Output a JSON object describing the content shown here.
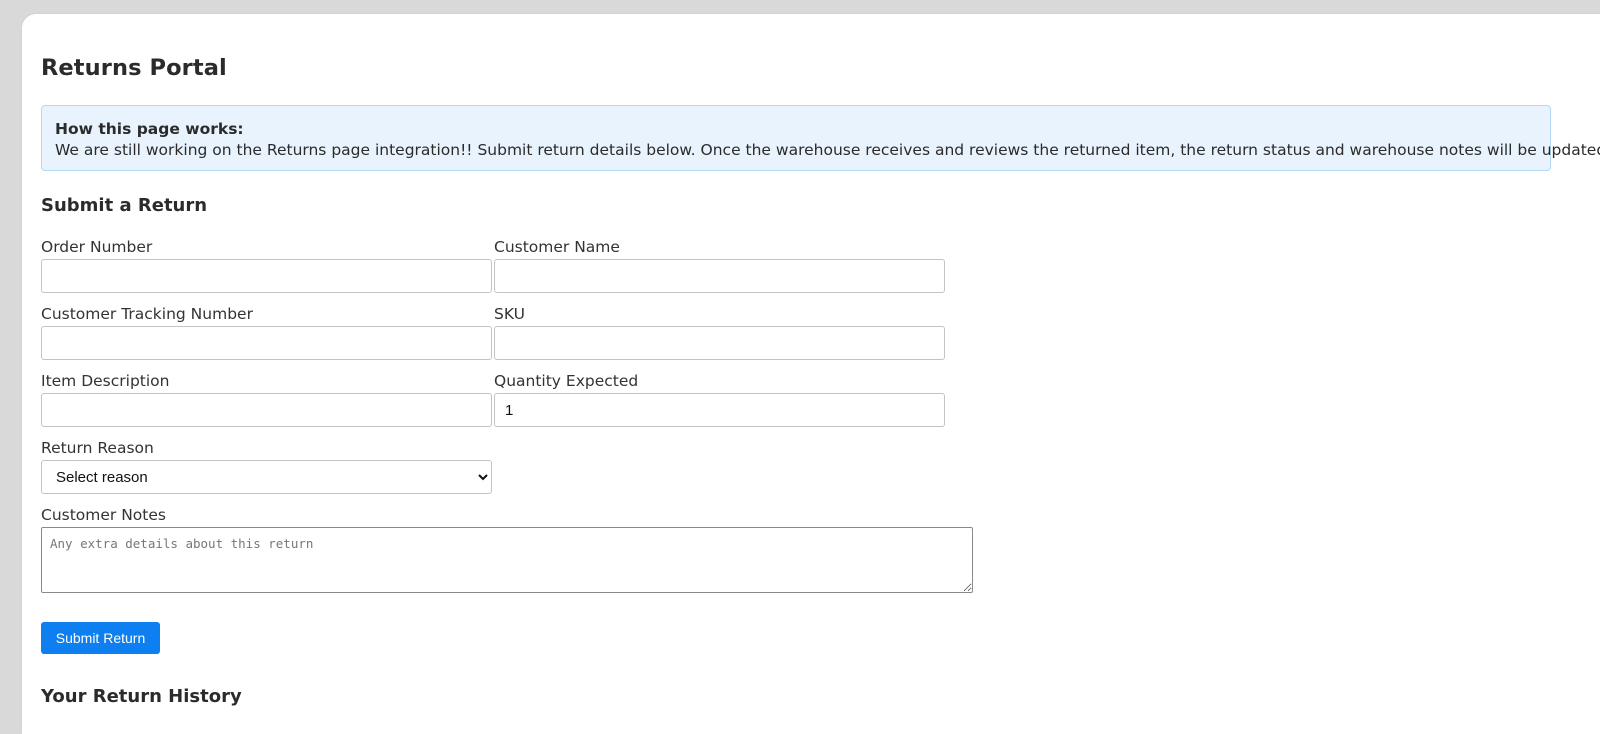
{
  "page": {
    "title": "Returns Portal"
  },
  "info_box": {
    "title": "How this page works:",
    "text": "We are still working on the Returns page integration!! Submit return details below. Once the warehouse receives and reviews the returned item, the return status and warehouse notes will be updated here."
  },
  "form": {
    "heading": "Submit a Return",
    "order_number": {
      "label": "Order Number",
      "value": ""
    },
    "customer_name": {
      "label": "Customer Name",
      "value": ""
    },
    "tracking_number": {
      "label": "Customer Tracking Number",
      "value": ""
    },
    "sku": {
      "label": "SKU",
      "value": ""
    },
    "item_description": {
      "label": "Item Description",
      "value": ""
    },
    "quantity_expected": {
      "label": "Quantity Expected",
      "value": "1"
    },
    "return_reason": {
      "label": "Return Reason",
      "selected": "Select reason"
    },
    "customer_notes": {
      "label": "Customer Notes",
      "placeholder": "Any extra details about this return"
    },
    "submit_label": "Submit Return"
  },
  "history": {
    "heading": "Your Return History"
  },
  "colors": {
    "accent": "#0d7ff0",
    "info_bg": "#e8f3fd",
    "info_border": "#b6d9f5"
  }
}
